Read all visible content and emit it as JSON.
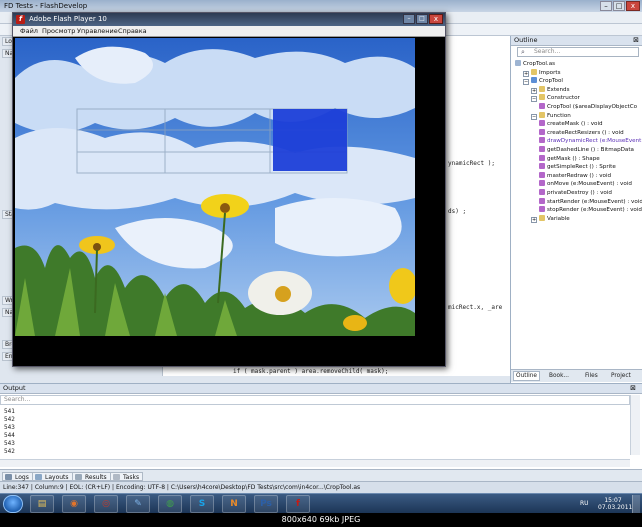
{
  "ide": {
    "title": "FD Tests - FlashDevelop",
    "window_controls": {
      "minimize": "–",
      "maximize": "□",
      "close": "x"
    },
    "left_tabs": [
      "Loc",
      "Na",
      "Sta",
      "Wr",
      "Na",
      "Bre",
      "Ent"
    ],
    "code_fragments": [
      "ynamicRect );",
      "ds) ;",
      "micRect.x, _are",
      "if ( mask.parent ) area.removeChild( mask);"
    ]
  },
  "outline": {
    "header": "Outline",
    "pin": "⊠",
    "search_placeholder": "Search...",
    "tree": [
      {
        "label": "CropTool.as",
        "indent": 0,
        "icon": "file",
        "exp": ""
      },
      {
        "label": "Imports",
        "indent": 1,
        "icon": "folder",
        "exp": "+"
      },
      {
        "label": "CropTool",
        "indent": 1,
        "icon": "class",
        "exp": "−"
      },
      {
        "label": "Extends",
        "indent": 2,
        "icon": "folder",
        "exp": "+"
      },
      {
        "label": "Constructor",
        "indent": 2,
        "icon": "folder",
        "exp": "−"
      },
      {
        "label": "CropTool ($areaDisplayObjectCo",
        "indent": 3,
        "icon": "method",
        "exp": ""
      },
      {
        "label": "Function",
        "indent": 2,
        "icon": "folder",
        "exp": "−"
      },
      {
        "label": "createMask () : void",
        "indent": 3,
        "icon": "method",
        "exp": ""
      },
      {
        "label": "createRectResizers () : void",
        "indent": 3,
        "icon": "method",
        "exp": ""
      },
      {
        "label": "drawDynamicRect (e:MouseEvent",
        "indent": 3,
        "icon": "method",
        "exp": "",
        "highlight": true
      },
      {
        "label": "getDashedLine () : BitmapData",
        "indent": 3,
        "icon": "method",
        "exp": ""
      },
      {
        "label": "getMask () : Shape",
        "indent": 3,
        "icon": "method",
        "exp": ""
      },
      {
        "label": "getSimpleRect () : Sprite",
        "indent": 3,
        "icon": "method",
        "exp": ""
      },
      {
        "label": "masterRedraw () : void",
        "indent": 3,
        "icon": "method",
        "exp": ""
      },
      {
        "label": "onMove (e:MouseEvent) : void",
        "indent": 3,
        "icon": "method",
        "exp": ""
      },
      {
        "label": "privateDestroy () : void",
        "indent": 3,
        "icon": "method",
        "exp": ""
      },
      {
        "label": "startRender (e:MouseEvent) : void",
        "indent": 3,
        "icon": "method",
        "exp": ""
      },
      {
        "label": "stopRender (e:MouseEvent) : void",
        "indent": 3,
        "icon": "method",
        "exp": ""
      },
      {
        "label": "Variable",
        "indent": 2,
        "icon": "folder",
        "exp": "+"
      }
    ],
    "tabs": [
      "Outline",
      "Book...",
      "Files",
      "Project"
    ]
  },
  "output": {
    "header": "Output",
    "pin": "⊠",
    "search_placeholder": "Search...",
    "lines": [
      "541",
      "542",
      "543",
      "544",
      "543",
      "542"
    ]
  },
  "bottom_tabs": [
    "Logs",
    "Layouts",
    "Results",
    "Tasks"
  ],
  "status": "Line:347 | Column:9 | EOL: (CR+LF) | Encoding: UTF-8 | C:\\Users\\h4core\\Desktop\\FD Tests\\src\\com\\in4cor...\\CropTool.as",
  "flash": {
    "title": "Adobe Flash Player 10",
    "icon_glyph": "f",
    "menu": [
      "Файл",
      "Просмотр",
      "Управление",
      "Справка"
    ],
    "window_controls": {
      "minimize": "–",
      "maximize": "□",
      "close": "x"
    }
  },
  "taskbar": {
    "apps": [
      {
        "name": "explorer-icon",
        "glyph": "▤",
        "color": "#e8c35a"
      },
      {
        "name": "firefox-icon",
        "glyph": "◉",
        "color": "#e3742a"
      },
      {
        "name": "media-icon",
        "glyph": "◎",
        "color": "#c43a2a"
      },
      {
        "name": "paint-icon",
        "glyph": "✎",
        "color": "#7fb3e8"
      },
      {
        "name": "chrome-icon",
        "glyph": "◍",
        "color": "#3fa24a"
      },
      {
        "name": "skype-icon",
        "glyph": "S",
        "color": "#1aa3e8"
      },
      {
        "name": "flashdevelop-icon",
        "glyph": "N",
        "color": "#e88a2a"
      },
      {
        "name": "photoshop-icon",
        "glyph": "Ps",
        "color": "#2b5fa8"
      },
      {
        "name": "flashplayer-icon",
        "glyph": "f",
        "color": "#c31c16"
      }
    ],
    "lang": "RU",
    "time": "15:07",
    "date": "07.03.2011"
  },
  "caption": "800x640  69kb  JPEG"
}
